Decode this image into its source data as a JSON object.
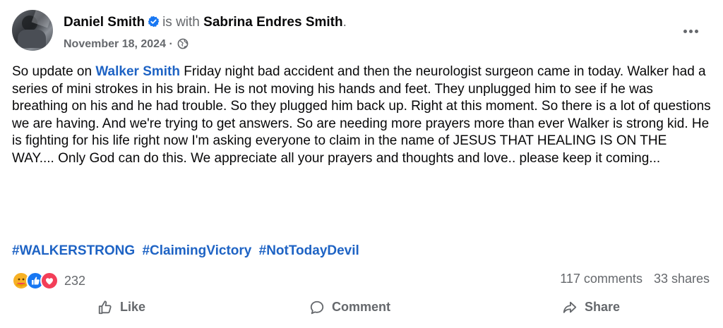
{
  "post": {
    "author": "Daniel Smith",
    "with_text": "is with",
    "tagged_person": "Sabrina Endres Smith",
    "period": ".",
    "date": "November 18, 2024",
    "separator": "·",
    "text_before_mention": "So update on ",
    "mention": "Walker Smith",
    "text_after_mention": " Friday night bad accident and then the neurologist surgeon came in today. Walker had a series of mini strokes in his brain. He is not moving his hands and feet. They unplugged him to see if he was breathing on his and he had trouble. So they plugged him back up. Right at this moment. So there is a lot of questions we are having. And we're trying to get answers. So are needing more prayers more than ever Walker is strong kid. He is fighting for his life right now I'm asking everyone to claim in the name of JESUS THAT HEALING IS ON THE WAY.... Only God can do this. We appreciate all your prayers and thoughts and love.. please keep it coming...",
    "hashtags": [
      "#WALKERSTRONG",
      "#ClaimingVictory",
      "#NotTodayDevil"
    ]
  },
  "engagement": {
    "reaction_count": "232",
    "comments": "117 comments",
    "shares": "33 shares"
  },
  "actions": {
    "like": "Like",
    "comment": "Comment",
    "share": "Share"
  },
  "colors": {
    "link": "#1e63c4",
    "secondary_text": "#65686c",
    "verified": "#1877f2"
  },
  "icons": [
    "verified-badge-icon",
    "globe-icon",
    "more-options-icon",
    "care-reaction-icon",
    "like-reaction-icon",
    "love-reaction-icon",
    "thumbs-up-icon",
    "comment-icon",
    "share-icon"
  ]
}
